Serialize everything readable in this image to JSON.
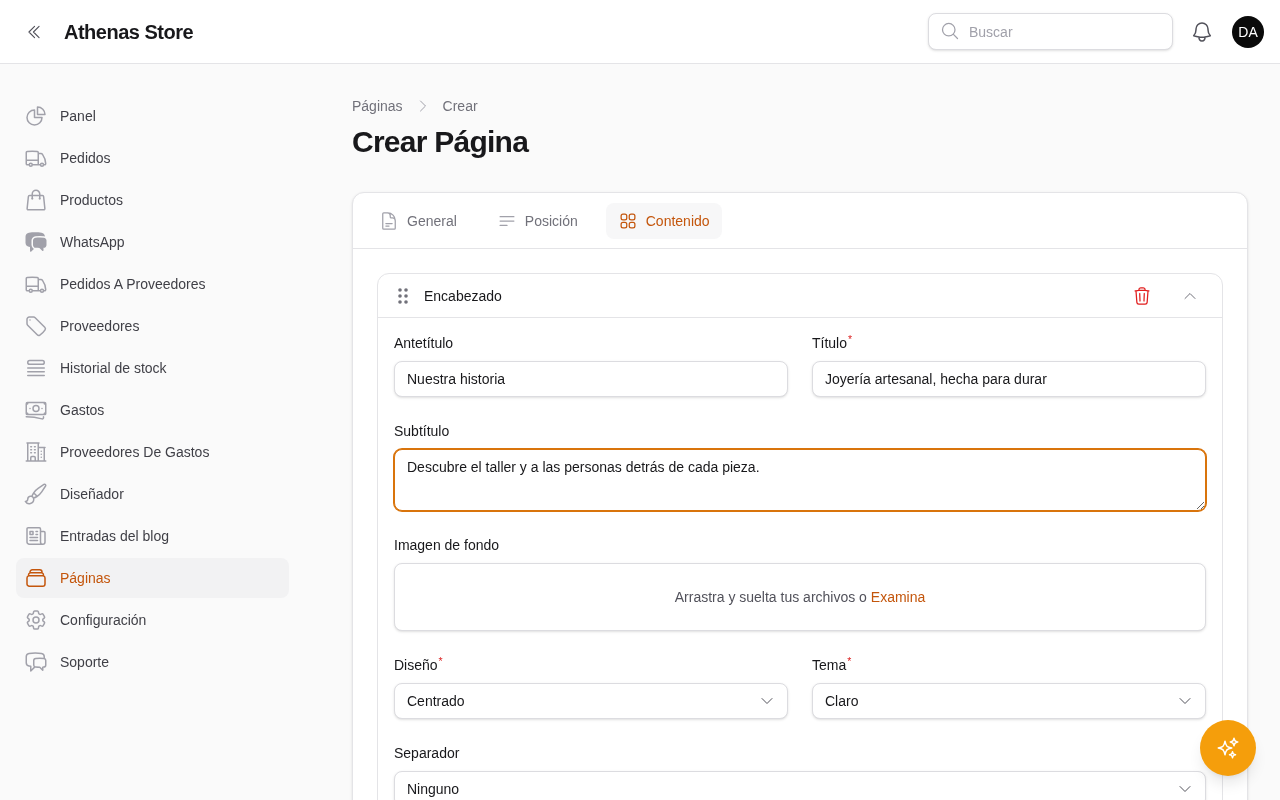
{
  "header": {
    "title": "Athenas Store",
    "search": {
      "placeholder": "Buscar"
    },
    "avatar": "DA"
  },
  "sidebar": {
    "items": [
      {
        "label": "Panel",
        "selected": false
      },
      {
        "label": "Pedidos",
        "selected": false
      },
      {
        "label": "Productos",
        "selected": false
      },
      {
        "label": "WhatsApp",
        "selected": false
      },
      {
        "label": "Pedidos A Proveedores",
        "selected": false
      },
      {
        "label": "Proveedores",
        "selected": false
      },
      {
        "label": "Historial de stock",
        "selected": false
      },
      {
        "label": "Gastos",
        "selected": false
      },
      {
        "label": "Proveedores De Gastos",
        "selected": false
      },
      {
        "label": "Diseñador",
        "selected": false
      },
      {
        "label": "Entradas del blog",
        "selected": false
      },
      {
        "label": "Páginas",
        "selected": true
      },
      {
        "label": "Configuración",
        "selected": false
      },
      {
        "label": "Soporte",
        "selected": false
      }
    ]
  },
  "breadcrumbs": [
    "Páginas",
    "Crear"
  ],
  "page_title": "Crear Página",
  "tabs": [
    {
      "label": "General",
      "selected": false
    },
    {
      "label": "Posición",
      "selected": false
    },
    {
      "label": "Contenido",
      "selected": true
    }
  ],
  "block": {
    "title": "Encabezado",
    "expanded": true,
    "rows": [
      [
        {
          "kind": "text",
          "label": "Antetítulo",
          "value": "Nuestra historia",
          "focused": false
        },
        {
          "kind": "text",
          "label": "Título$^{*}$",
          "value": "Joyería artesanal, hecha para durar",
          "focused": false
        }
      ],
      [
        {
          "kind": "textarea",
          "label": "Subtítulo",
          "value": "Descubre el taller y a las personas detrás de cada pieza.",
          "focused": true
        }
      ],
      [
        {
          "kind": "file",
          "label": "Imagen de fondo",
          "prompt": "Arrastra y suelta tus archivos o",
          "link": "Examina",
          "focused": false
        }
      ],
      [
        {
          "kind": "select",
          "label": "Diseño$^{*}$",
          "value": "Centrado",
          "focused": false
        },
        {
          "kind": "select",
          "label": "Tema$^{*}$",
          "value": "Claro",
          "focused": false
        }
      ],
      [
        {
          "kind": "select",
          "label": "Separador",
          "value": "Ninguno",
          "focused": false
        }
      ]
    ]
  }
}
